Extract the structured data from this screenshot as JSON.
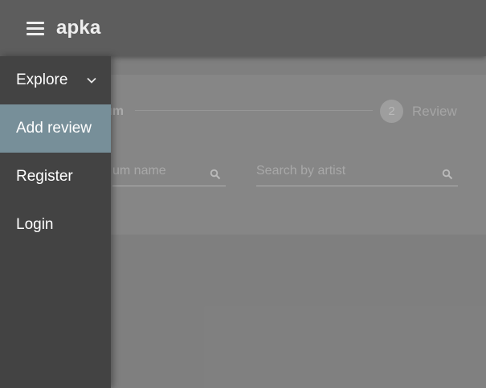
{
  "appbar": {
    "title": "apka",
    "menu_icon": "hamburger-menu-icon"
  },
  "drawer": {
    "items": [
      {
        "label": "Explore",
        "active": false,
        "icon": "chevron-down-icon"
      },
      {
        "label": "Add review",
        "active": true
      },
      {
        "label": "Register",
        "active": false
      },
      {
        "label": "Login",
        "active": false
      }
    ]
  },
  "stepper": {
    "step1_label_visible": "um",
    "step2_number": "2",
    "step2_label": "Review"
  },
  "search": {
    "album_placeholder_visible": "um name",
    "artist_placeholder": "Search by artist",
    "icon": "search-icon"
  },
  "colors": {
    "appbar": "#626262",
    "drawer": "#434343",
    "active_item": "#778f99",
    "content": "#878787"
  }
}
